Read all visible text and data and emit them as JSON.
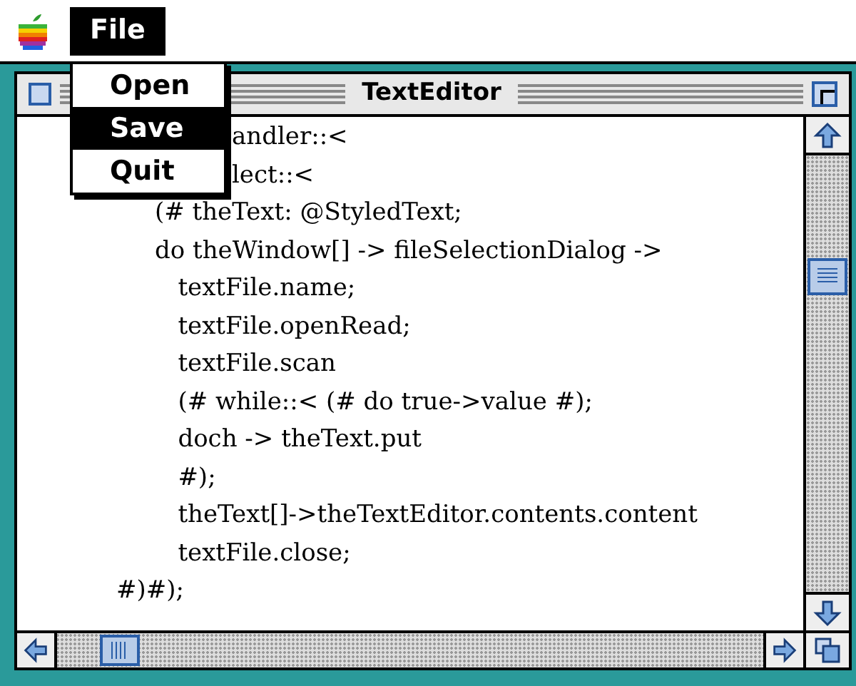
{
  "menu_bar": {
    "menus": [
      {
        "label": "File",
        "selected": true
      }
    ]
  },
  "menu": {
    "items": [
      {
        "label": "Open",
        "selected": false
      },
      {
        "label": "Save",
        "selected": true
      },
      {
        "label": "Quit",
        "selected": false
      }
    ]
  },
  "window": {
    "title": "TextEditor"
  },
  "code_lines": [
    "                          andler::<",
    "                          lect::<",
    "                (# theText: @StyledText;",
    "                do theWindow[] -> fileSelectionDialog ->",
    "                   textFile.name;",
    "                   textFile.openRead;",
    "                   textFile.scan",
    "                   (# while::< (# do true->value #);",
    "                   doch -> theText.put",
    "                   #);",
    "                   theText[]->theTextEditor.contents.content",
    "                   textFile.close;",
    "           #)#);"
  ]
}
